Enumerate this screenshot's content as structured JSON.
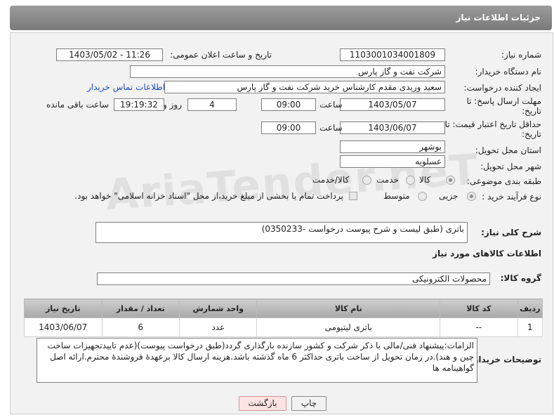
{
  "header": {
    "title": "جزئیات اطلاعات نیاز"
  },
  "form": {
    "need_number_label": "شماره نیاز:",
    "need_number": "1103001034001809",
    "announce_label": "تاریخ و ساعت اعلان عمومی:",
    "announce_value": "1403/05/02 - 11:26",
    "buyer_org_label": "نام دستگاه خریدار:",
    "buyer_org": "شرکت نفت و گاز پارس",
    "requester_label": "ایجاد کننده درخواست:",
    "requester": "سعید وریدی مقدم کارشناس خرید شرکت نفت و گاز پارس",
    "contact_link": "اطلاعات تماس خریدار",
    "reply_deadline_label1": "مهلت ارسال پاسخ: تا",
    "reply_deadline_label2": "تاریخ:",
    "reply_date": "1403/05/07",
    "time_label": "ساعت",
    "reply_time": "09:00",
    "days_value": "4",
    "days_label": "روز و",
    "remaining_time": "19:19:32",
    "remaining_label": "ساعت باقی مانده",
    "validity_label1": "حداقل تاریخ اعتبار قیمت: تا",
    "validity_label2": "تاریخ:",
    "validity_date": "1403/06/07",
    "validity_time": "09:00",
    "province_label": "استان محل تحویل:",
    "province": "بوشهر",
    "city_label": "شهر محل تحویل:",
    "city": "عسلویه",
    "category_label": "طبقه بندی موضوعی:",
    "category_options": [
      "کالا",
      "خدمت",
      "کالا/خدمت"
    ],
    "process_label": "نوع فرآیند خرید :",
    "process_options": [
      "جزیی",
      "متوسط"
    ],
    "payment_note": "پرداخت تمام یا بخشی از مبلغ خرید،از محل \"اسناد خزانه اسلامی\" خواهد بود."
  },
  "description": {
    "label": "شرح کلی نیاز:",
    "value": "باتری (طبق لیست و شرح پیوست درخواست -0350233)"
  },
  "goods_section": {
    "title": "اطلاعات کالاهای مورد نیاز",
    "group_label": "گروه کالا:",
    "group_value": "محصولات الکترونیکی"
  },
  "table": {
    "headers": [
      "ردیف",
      "کد کالا",
      "نام کالا",
      "واحد شمارش",
      "تعداد / مقدار",
      "تاریخ نیاز"
    ],
    "rows": [
      [
        "1",
        "--",
        "باتری لیتیومی",
        "عدد",
        "6",
        "1403/06/07"
      ]
    ]
  },
  "buyer_notes": {
    "label": "توضیحات خریدار:",
    "value": "الزامات:پیشنهاد فنی/مالی با ذکر شرکت و کشور سازنده بارگذاری گردد(طبق درخواست پیوست)(عدم تاییدتجهیزات ساخت چین و هند).در زمان تحویل از ساخت باتری حداکثر 6 ماه گذشته باشد.هزینه ارسال کالا برعهدۀ فروشندۀ محترم.ارائه اصل گواهینامه ها"
  },
  "buttons": {
    "print": "چاپ",
    "back": "بازگشت"
  },
  "watermark": "AriaTender.neT"
}
